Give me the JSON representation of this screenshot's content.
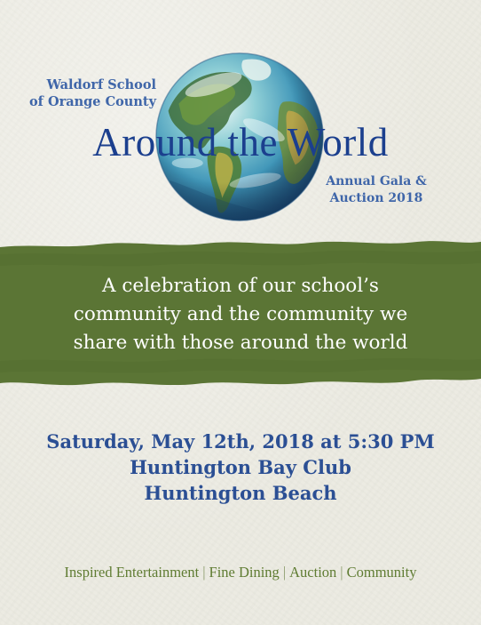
{
  "header": {
    "school_line1": "Waldorf School",
    "school_line2": "of Orange County",
    "title": "Around the World",
    "gala_line1": "Annual Gala &",
    "gala_line2": "Auction 2018"
  },
  "banner": {
    "tagline_line1": "A celebration of our school’s",
    "tagline_line2": "community and the community we",
    "tagline_line3": "share with those around the world",
    "color": "#5b7535"
  },
  "details": {
    "date_time": "Saturday, May 12th, 2018 at 5:30 PM",
    "venue": "Huntington Bay Club",
    "city": "Huntington Beach"
  },
  "features": {
    "items": [
      "Inspired Entertainment",
      "Fine Dining",
      "Auction",
      "Community"
    ],
    "separator": "|"
  },
  "colors": {
    "title_blue": "#1b3f8e",
    "accent_blue": "#3f66a9",
    "details_blue": "#2b4f94",
    "feature_green": "#5f7c32",
    "paper": "#ecebe2"
  }
}
